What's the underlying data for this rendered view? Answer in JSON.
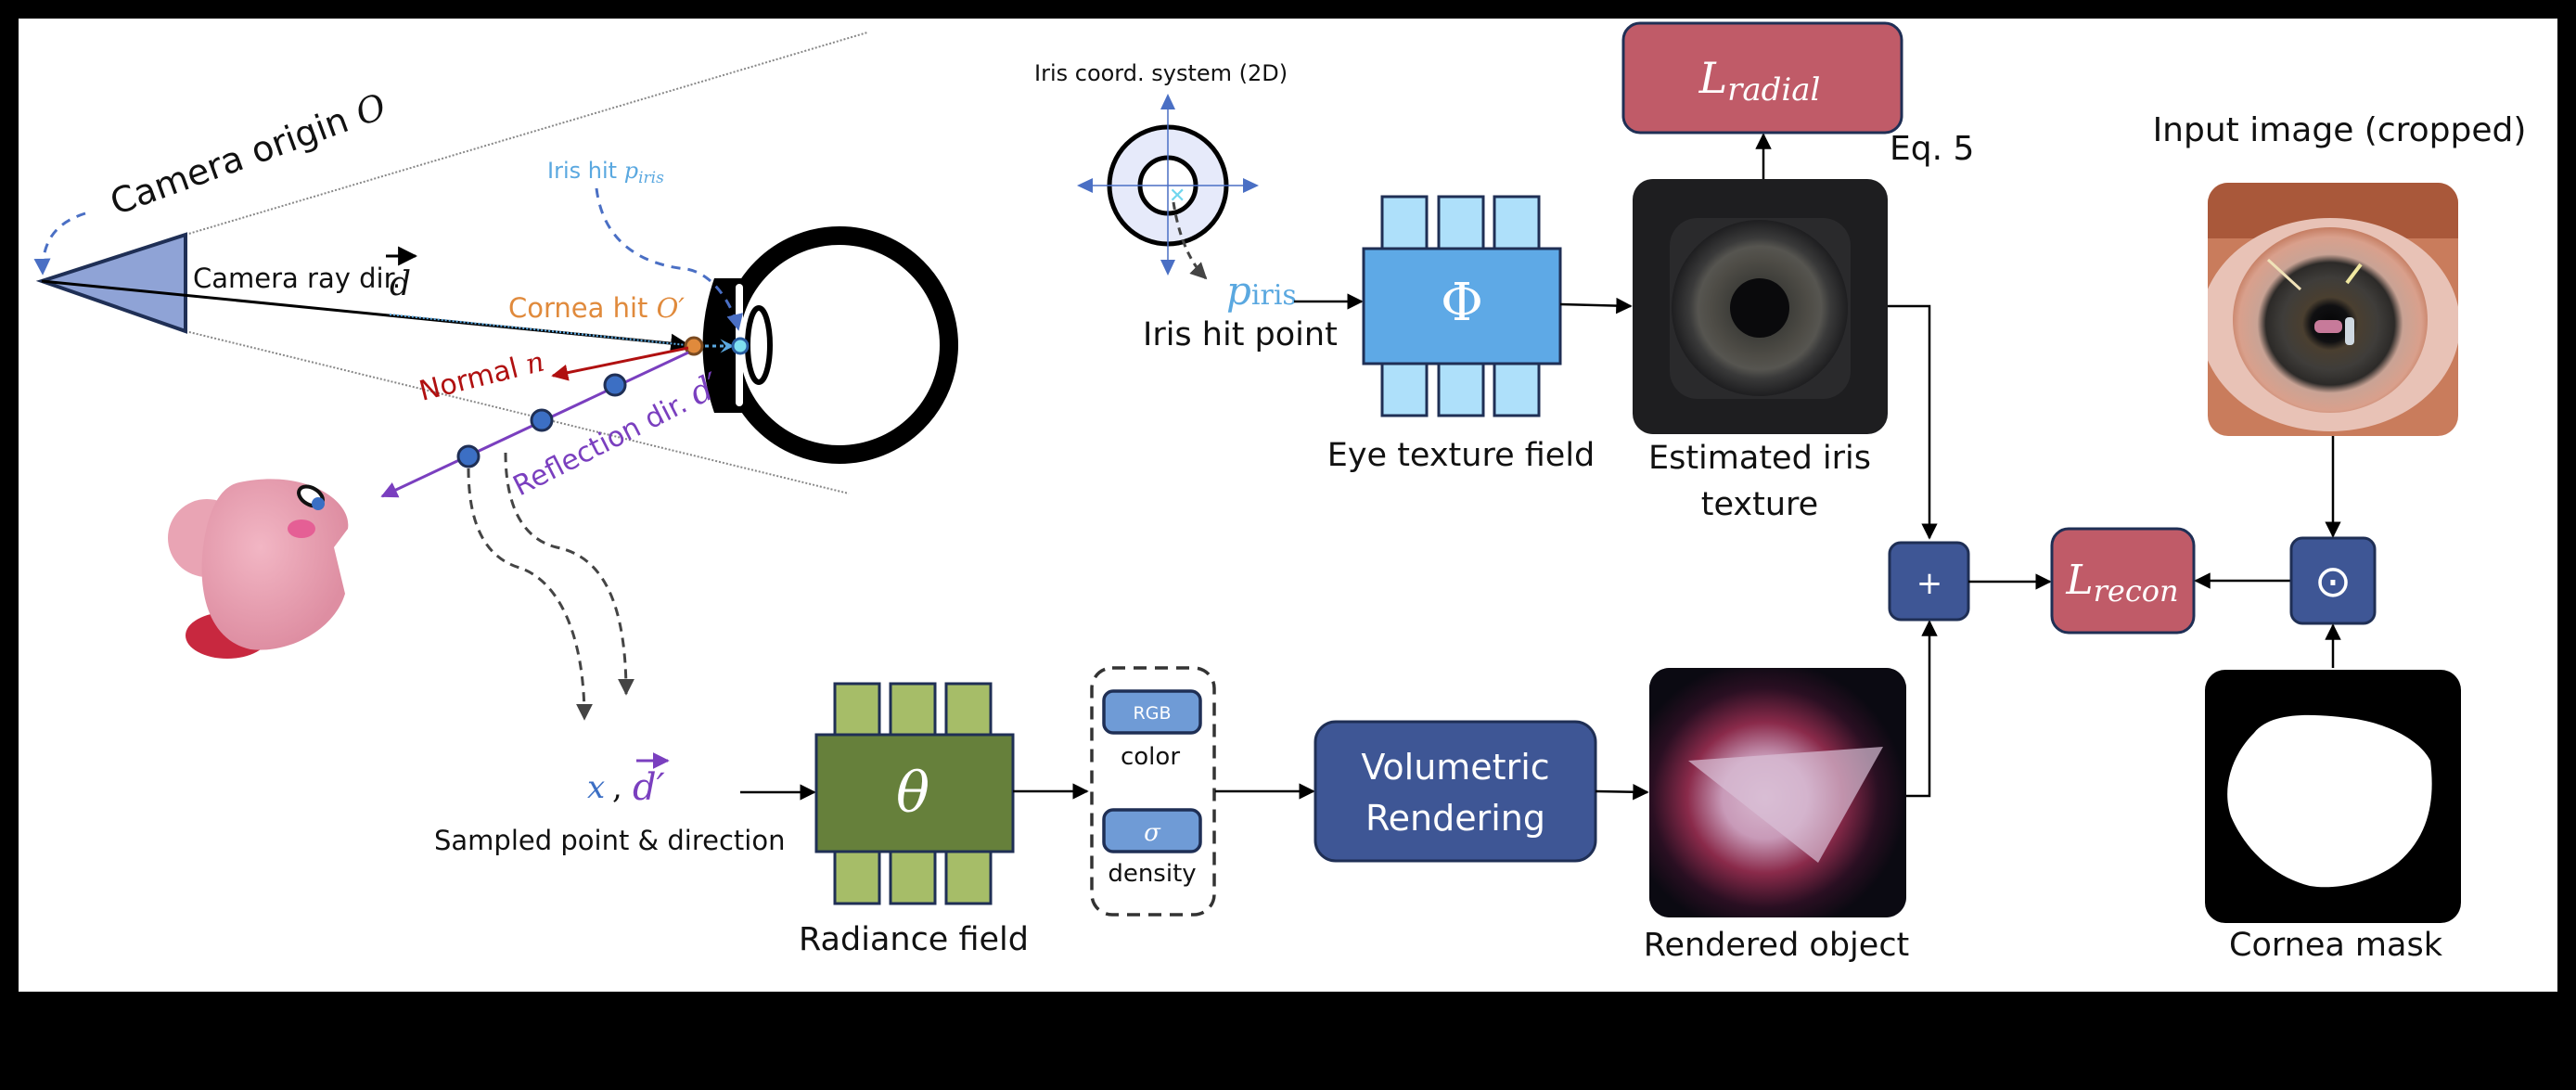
{
  "colors": {
    "camera_fill": "#8fa3d6",
    "camera_stroke": "#1f2f55",
    "dashed_blue": "#4a6fc4",
    "iris_label": "#5aa8e0",
    "cornea_label": "#e08a3c",
    "normal_red": "#b01010",
    "reflection_purple": "#7a3fbf",
    "sample_dot": "#3c6fc4",
    "phi_main": "#5ea9e6",
    "phi_bars": "#aee0fa",
    "theta_main": "#66803b",
    "theta_bars": "#a6bd68",
    "loss_fill": "#c05b68",
    "op_fill": "#3e5695",
    "volumetric_fill": "#3e5695",
    "output_chip": "#6f9bd6",
    "dark_stroke": "#1f2f55"
  },
  "scene": {
    "camera_origin_label": "Camera origin",
    "camera_origin_symbol": "O",
    "camera_ray_label": "Camera ray dir.",
    "camera_ray_symbol": "d",
    "cornea_hit_label": "Cornea hit",
    "cornea_hit_symbol": "O′",
    "iris_hit_label": "Iris hit",
    "iris_hit_symbol": "p",
    "iris_hit_subscript": "iris",
    "normal_label": "Normal",
    "normal_symbol": "n",
    "reflection_label": "Reflection dir.",
    "reflection_symbol": "d′",
    "object_name": "Kirby figurine"
  },
  "iris_branch": {
    "coord_system_label": "Iris coord. system (2D)",
    "point_symbol": "p",
    "point_subscript": "iris",
    "point_label": "Iris hit point",
    "field_symbol": "Φ",
    "field_label": "Eye texture field",
    "texture_label_line1": "Estimated iris",
    "texture_label_line2": "texture",
    "loss_symbol": "L",
    "loss_subscript": "radial",
    "loss_eq": "Eq. 5"
  },
  "radiance_branch": {
    "input_x": "x",
    "input_sep": ",",
    "input_d": "d′",
    "input_label": "Sampled point & direction",
    "field_symbol": "θ",
    "field_label": "Radiance field",
    "output_rgb": "RGB",
    "output_rgb_label": "color",
    "output_sigma": "σ",
    "output_sigma_label": "density",
    "render_line1": "Volumetric",
    "render_line2": "Rendering",
    "rendered_label": "Rendered object"
  },
  "recon": {
    "plus_symbol": "+",
    "loss_symbol": "L",
    "loss_subscript": "recon",
    "odot_symbol": "⊙",
    "input_image_label": "Input image (cropped)",
    "mask_label": "Cornea mask"
  }
}
